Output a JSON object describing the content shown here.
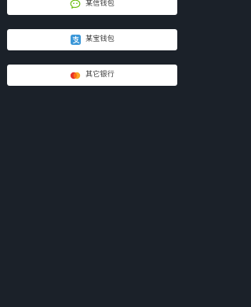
{
  "payment_options": [
    {
      "label": "某信钱包",
      "icon": "wechat-icon",
      "icon_color": "#62b900"
    },
    {
      "label": "某宝钱包",
      "icon": "alipay-icon",
      "icon_color": "#3b97d8"
    },
    {
      "label": "其它银行",
      "icon": "mastercard-icon",
      "icon_colors": [
        "#e6332a",
        "#f7a21b"
      ]
    }
  ],
  "colors": {
    "background": "#1b2129",
    "button_background": "#ffffff",
    "text": "#3a3a3a"
  }
}
